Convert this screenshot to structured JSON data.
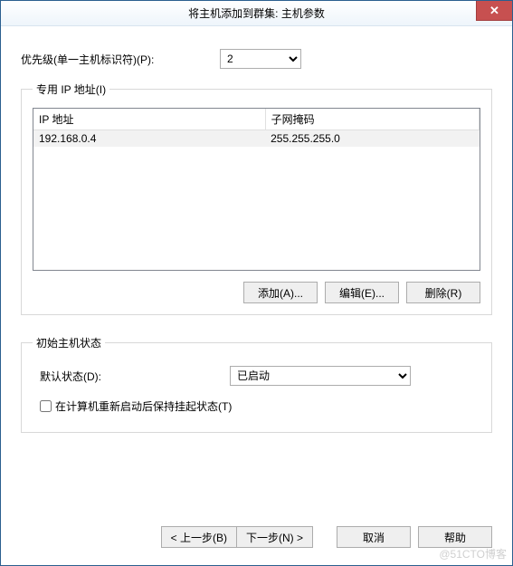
{
  "title": "将主机添加到群集: 主机参数",
  "priority": {
    "label": "优先级(单一主机标识符)(P):",
    "value": "2"
  },
  "ipGroup": {
    "legend": "专用 IP 地址(I)",
    "columns": {
      "ip": "IP 地址",
      "mask": "子网掩码"
    },
    "rows": [
      {
        "ip": "192.168.0.4",
        "mask": "255.255.255.0"
      }
    ],
    "buttons": {
      "add": "添加(A)...",
      "edit": "编辑(E)...",
      "remove": "删除(R)"
    }
  },
  "statusGroup": {
    "legend": "初始主机状态",
    "defaultLabel": "默认状态(D):",
    "defaultValue": "已启动",
    "retainLabel": "在计算机重新启动后保持挂起状态(T)"
  },
  "footer": {
    "back": "< 上一步(B)",
    "next": "下一步(N) >",
    "cancel": "取消",
    "help": "帮助"
  },
  "watermark": "@51CTO博客"
}
